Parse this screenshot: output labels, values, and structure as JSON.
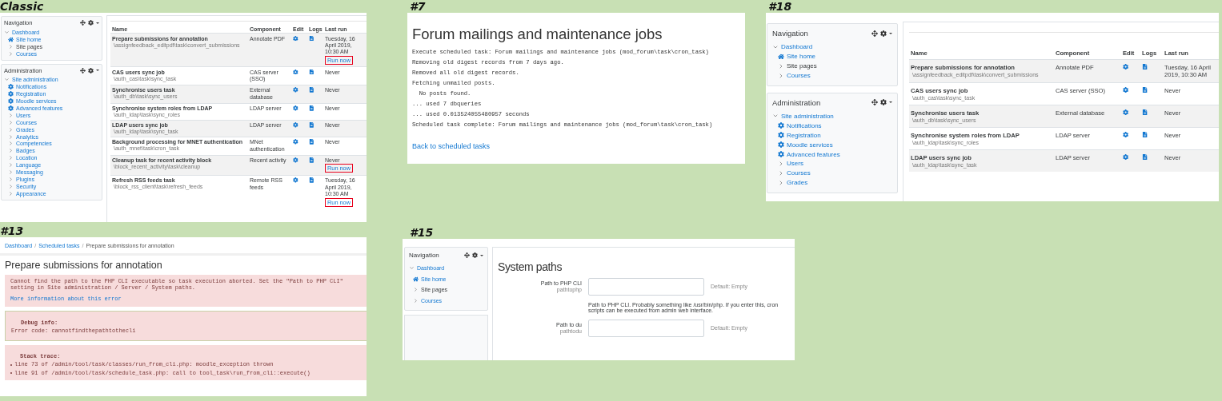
{
  "panels": [
    {
      "kind": "tasks",
      "label": "Classic",
      "blocks": [
        {
          "title": "Navigation",
          "items": [
            {
              "label": "Dashboard",
              "kind": "branch",
              "link": true,
              "expanded": true,
              "children": [
                {
                  "label": "Site home",
                  "kind": "home",
                  "link": true
                },
                {
                  "label": "Site pages",
                  "kind": "branch",
                  "link": false,
                  "expanded": false
                },
                {
                  "label": "Courses",
                  "kind": "branch",
                  "link": true,
                  "expanded": false
                }
              ]
            }
          ]
        },
        {
          "title": "Administration",
          "items": [
            {
              "label": "Site administration",
              "kind": "branch",
              "link": true,
              "expanded": true,
              "children": [
                {
                  "label": "Notifications",
                  "kind": "gear",
                  "link": true
                },
                {
                  "label": "Registration",
                  "kind": "gear",
                  "link": true
                },
                {
                  "label": "Moodle services",
                  "kind": "gear",
                  "link": true
                },
                {
                  "label": "Advanced features",
                  "kind": "gear",
                  "link": true
                },
                {
                  "label": "Users",
                  "kind": "branch",
                  "link": true,
                  "expanded": false
                },
                {
                  "label": "Courses",
                  "kind": "branch",
                  "link": true,
                  "expanded": false
                },
                {
                  "label": "Grades",
                  "kind": "branch",
                  "link": true,
                  "expanded": false
                },
                {
                  "label": "Analytics",
                  "kind": "branch",
                  "link": true,
                  "expanded": false
                },
                {
                  "label": "Competencies",
                  "kind": "branch",
                  "link": true,
                  "expanded": false
                },
                {
                  "label": "Badges",
                  "kind": "branch",
                  "link": true,
                  "expanded": false
                },
                {
                  "label": "Location",
                  "kind": "branch",
                  "link": true,
                  "expanded": false
                },
                {
                  "label": "Language",
                  "kind": "branch",
                  "link": true,
                  "expanded": false
                },
                {
                  "label": "Messaging",
                  "kind": "branch",
                  "link": true,
                  "expanded": false
                },
                {
                  "label": "Plugins",
                  "kind": "branch",
                  "link": true,
                  "expanded": false
                },
                {
                  "label": "Security",
                  "kind": "branch",
                  "link": true,
                  "expanded": false
                },
                {
                  "label": "Appearance",
                  "kind": "branch",
                  "link": true,
                  "expanded": false
                }
              ]
            }
          ]
        }
      ],
      "table": {
        "columns": [
          "Name",
          "Component",
          "Edit",
          "Logs",
          "Last run"
        ],
        "rows": [
          {
            "name": "Prepare submissions for annotation",
            "path": "\\assignfeedback_editpdf\\task\\convert_submissions",
            "component": "Annotate PDF",
            "last_run": "Tuesday, 16 April 2019, 10:30 AM",
            "run_now": {
              "label": "Run now",
              "highlighted": true
            }
          },
          {
            "name": "CAS users sync job",
            "path": "\\auth_cas\\task\\sync_task",
            "component": "CAS server (SSO)",
            "last_run": "Never"
          },
          {
            "name": "Synchronise users task",
            "path": "\\auth_db\\task\\sync_users",
            "component": "External database",
            "last_run": "Never"
          },
          {
            "name": "Synchronise system roles from LDAP",
            "path": "\\auth_ldap\\task\\sync_roles",
            "component": "LDAP server",
            "last_run": "Never"
          },
          {
            "name": "LDAP users sync job",
            "path": "\\auth_ldap\\task\\sync_task",
            "component": "LDAP server",
            "last_run": "Never"
          },
          {
            "name": "Background processing for MNET authentication",
            "path": "\\auth_mnet\\task\\cron_task",
            "component": "MNet authentication",
            "last_run": "Never"
          },
          {
            "name": "Cleanup task for recent activity block",
            "path": "\\block_recent_activity\\task\\cleanup",
            "component": "Recent activity",
            "last_run": "Never",
            "run_now": {
              "label": "Run now",
              "highlighted": true
            }
          },
          {
            "name": "Refresh RSS feeds task",
            "path": "\\block_rss_client\\task\\refresh_feeds",
            "component": "Remote RSS feeds",
            "last_run": "Tuesday, 16 April 2019, 10:30 AM",
            "run_now": {
              "label": "Run now",
              "highlighted": true
            }
          }
        ]
      }
    },
    {
      "kind": "log",
      "label": "#7",
      "title": "Forum mailings and maintenance jobs",
      "lines": [
        "Execute scheduled task: Forum mailings and maintenance jobs (mod_forum\\task\\cron_task)",
        "Removing old digest records from 7 days ago.",
        "Removed all old digest records.",
        "Fetching unmailed posts.",
        "  No posts found.",
        "... used 7 dbqueries",
        "... used 0.013524055480957 seconds",
        "Scheduled task complete: Forum mailings and maintenance jobs (mod_forum\\task\\cron_task)"
      ],
      "link": "Back to scheduled tasks"
    },
    {
      "kind": "tasks",
      "label": "#18",
      "blocks": [
        {
          "title": "Navigation",
          "items": [
            {
              "label": "Dashboard",
              "kind": "branch",
              "link": true,
              "expanded": true,
              "children": [
                {
                  "label": "Site home",
                  "kind": "home",
                  "link": true
                },
                {
                  "label": "Site pages",
                  "kind": "branch",
                  "link": false,
                  "expanded": false
                },
                {
                  "label": "Courses",
                  "kind": "branch",
                  "link": true,
                  "expanded": false
                }
              ]
            }
          ]
        },
        {
          "title": "Administration",
          "items": [
            {
              "label": "Site administration",
              "kind": "branch",
              "link": true,
              "expanded": true,
              "children": [
                {
                  "label": "Notifications",
                  "kind": "gear",
                  "link": true
                },
                {
                  "label": "Registration",
                  "kind": "gear",
                  "link": true
                },
                {
                  "label": "Moodle services",
                  "kind": "gear",
                  "link": true
                },
                {
                  "label": "Advanced features",
                  "kind": "gear",
                  "link": true
                },
                {
                  "label": "Users",
                  "kind": "branch",
                  "link": true,
                  "expanded": false
                },
                {
                  "label": "Courses",
                  "kind": "branch",
                  "link": true,
                  "expanded": false
                },
                {
                  "label": "Grades",
                  "kind": "branch",
                  "link": true,
                  "expanded": false
                }
              ]
            }
          ]
        }
      ],
      "table": {
        "columns": [
          "Name",
          "Component",
          "Edit",
          "Logs",
          "Last run"
        ],
        "rows": [
          {
            "name": "Prepare submissions for annotation",
            "path": "\\assignfeedback_editpdf\\task\\convert_submissions",
            "component": "Annotate PDF",
            "last_run": "Tuesday, 16 April 2019, 10:30 AM"
          },
          {
            "name": "CAS users sync job",
            "path": "\\auth_cas\\task\\sync_task",
            "component": "CAS server (SSO)",
            "last_run": "Never"
          },
          {
            "name": "Synchronise users task",
            "path": "\\auth_db\\task\\sync_users",
            "component": "External database",
            "last_run": "Never"
          },
          {
            "name": "Synchronise system roles from LDAP",
            "path": "\\auth_ldap\\task\\sync_roles",
            "component": "LDAP server",
            "last_run": "Never"
          },
          {
            "name": "LDAP users sync job",
            "path": "\\auth_ldap\\task\\sync_task",
            "component": "LDAP server",
            "last_run": "Never"
          }
        ]
      }
    },
    {
      "kind": "error",
      "label": "#13",
      "breadcrumb": [
        {
          "kind": "link",
          "text": "Dashboard"
        },
        {
          "kind": "separator",
          "text": "/"
        },
        {
          "kind": "link",
          "text": "Scheduled tasks"
        },
        {
          "kind": "separator",
          "text": "/"
        },
        {
          "kind": "current",
          "text": "Prepare submissions for annotation"
        }
      ],
      "title": "Prepare submissions for annotation",
      "message": "Cannot find the path to the PHP CLI executable so task execution aborted. Set the \"Path to PHP CLI\" setting in Site administration / Server / System paths.",
      "more_info": "More information about this error",
      "debug_heading": "Debug info:",
      "debug_line": "Error code: cannotfindthepathtothecli",
      "stack_heading": "Stack trace:",
      "stack": [
        "line 73 of /admin/tool/task/classes/run_from_cli.php: moodle_exception thrown",
        "line 91 of /admin/tool/task/schedule_task.php: call to tool_task\\run_from_cli::execute()"
      ]
    },
    {
      "kind": "settings",
      "label": "#15",
      "blocks": [
        {
          "title": "Navigation",
          "items": [
            {
              "label": "Dashboard",
              "kind": "branch",
              "link": true,
              "expanded": true,
              "children": [
                {
                  "label": "Site home",
                  "kind": "home",
                  "link": true
                },
                {
                  "label": "Site pages",
                  "kind": "branch",
                  "link": false,
                  "expanded": false
                },
                {
                  "label": "Courses",
                  "kind": "branch",
                  "link": true,
                  "expanded": false
                }
              ]
            }
          ]
        }
      ],
      "title": "System paths",
      "settings": [
        {
          "label": "Path to PHP CLI",
          "name": "pathtophp",
          "default": "Default: Empty",
          "description": "Path to PHP CLI. Probably something like /usr/bin/php. If you enter this, cron scripts can be executed from admin web interface."
        },
        {
          "label": "Path to du",
          "name": "pathtodu",
          "default": "Default: Empty"
        }
      ]
    }
  ]
}
